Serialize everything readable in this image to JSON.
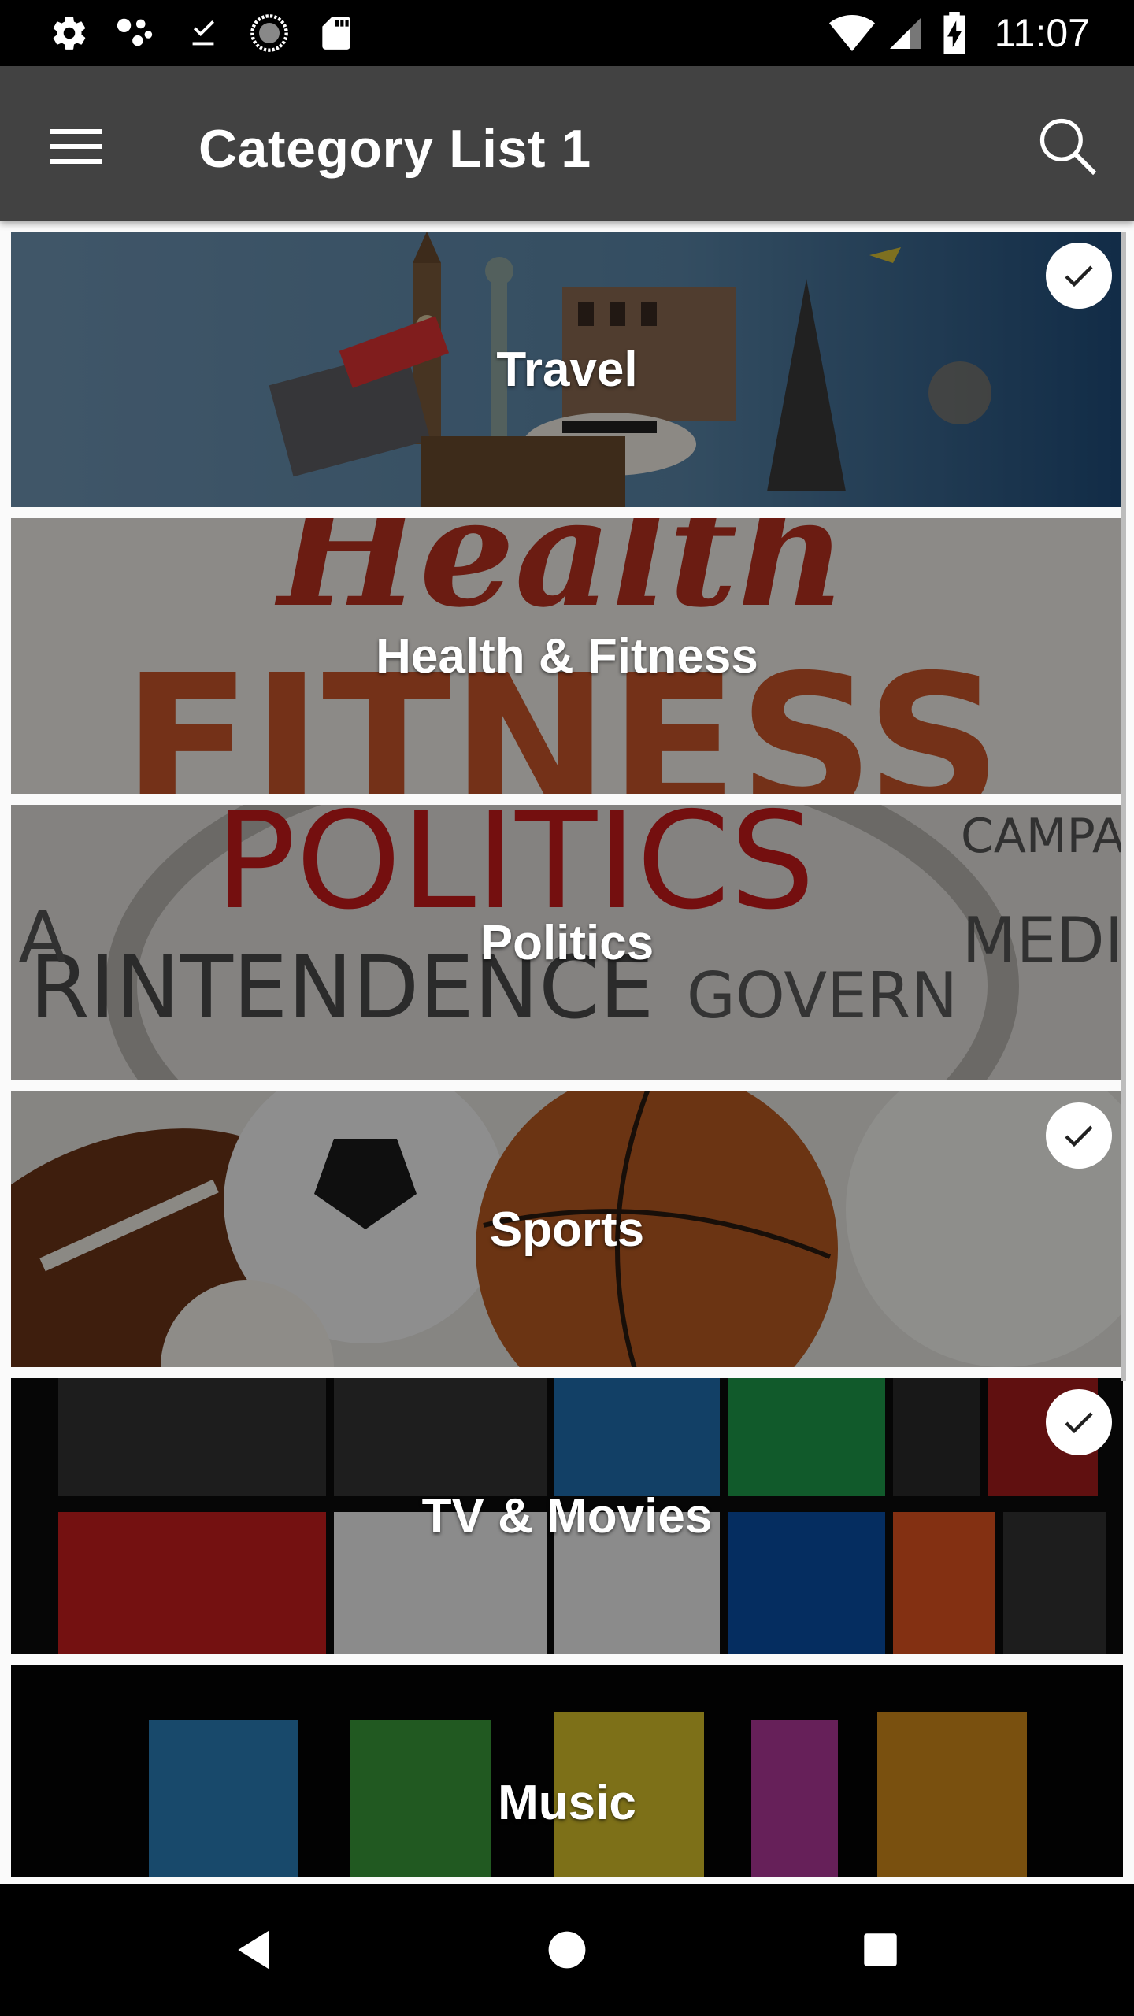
{
  "status_bar": {
    "time": "11:07",
    "icons": [
      "settings-icon",
      "assistant-dots-icon",
      "download-done-icon",
      "sync-circle-icon",
      "sd-card-icon",
      "wifi-icon",
      "signal-icon",
      "battery-charging-icon"
    ]
  },
  "app_bar": {
    "title": "Category List 1",
    "menu_icon": "hamburger-menu-icon",
    "search_icon": "search-icon"
  },
  "categories": [
    {
      "label": "Travel",
      "selected": true,
      "theme_color": "#4d7a9a"
    },
    {
      "label": "Health & Fitness",
      "selected": false,
      "theme_color": "#c96a3c"
    },
    {
      "label": "Politics",
      "selected": false,
      "theme_color": "#b9b6b2"
    },
    {
      "label": "Sports",
      "selected": true,
      "theme_color": "#8e4a24"
    },
    {
      "label": "TV & Movies",
      "selected": true,
      "theme_color": "#2a2a2a"
    },
    {
      "label": "Music",
      "selected": false,
      "theme_color": "#111111"
    }
  ],
  "nav_bar": {
    "buttons": [
      "back-icon",
      "home-icon",
      "recents-icon"
    ]
  },
  "colors": {
    "app_bar": "#424242",
    "status_bar": "#000000",
    "check_bg": "#ffffff",
    "check_mark": "#212121"
  }
}
